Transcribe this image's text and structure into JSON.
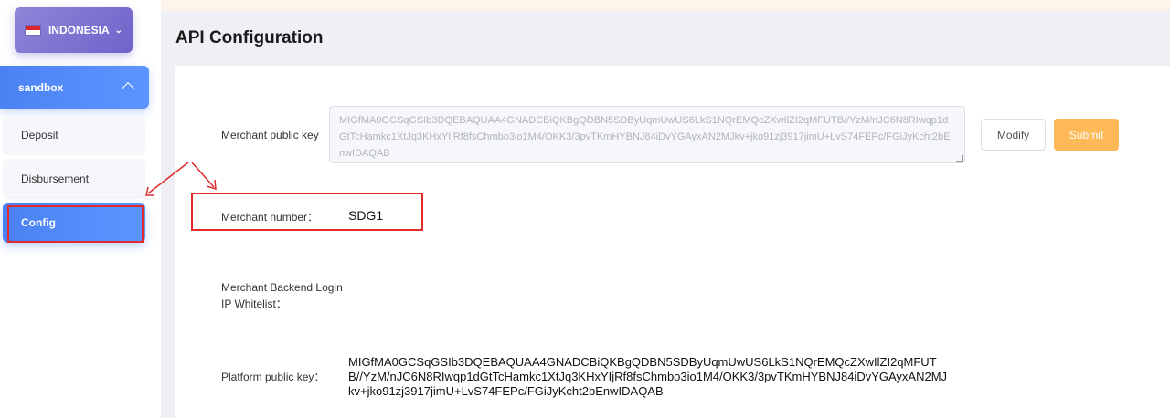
{
  "sidebar": {
    "country": "INDONESIA",
    "environment": "sandbox",
    "items": [
      {
        "label": "Deposit"
      },
      {
        "label": "Disbursement"
      },
      {
        "label": "Config"
      }
    ]
  },
  "page": {
    "title": "API Configuration"
  },
  "config": {
    "merchant_public_key_label": "Merchant public key",
    "merchant_public_key_value": "MIGfMA0GCSqGSIb3DQEBAQUAA4GNADCBiQKBgQDBN5SDByUqmUwUS6LkS1NQrEMQcZXwIlZI2qMFUTB//YzM/nJC6N8RIwqp1dGtTcHamkc1XtJq3KHxYIjRf8fsChmbo3io1M4/OKK3/3pvTKmHYBNJ84iDvYGAyxAN2MJkv+jko91zj3917jimU+LvS74FEPc/FGiJyKcht2bEnwIDAQAB",
    "modify_label": "Modify",
    "submit_label": "Submit",
    "merchant_number_label": "Merchant number：",
    "merchant_number_value": "SDG1",
    "ip_whitelist_label": "Merchant Backend Login IP Whitelist：",
    "platform_public_key_label": "Platform public key：",
    "platform_public_key_value": "MIGfMA0GCSqGSIb3DQEBAQUAA4GNADCBiQKBgQDBN5SDByUqmUwUS6LkS1NQrEMQcZXwIlZI2qMFUTB//YzM/nJC6N8RIwqp1dGtTcHamkc1XtJq3KHxYIjRf8fsChmbo3io1M4/OKK3/3pvTKmHYBNJ84iDvYGAyxAN2MJkv+jko91zj3917jimU+LvS74FEPc/FGiJyKcht2bEnwIDAQAB"
  },
  "colors": {
    "accent_blue": "#4a82f4",
    "country_purple": "#7c72d1",
    "submit_orange": "#fdb857",
    "annotation_red": "#e12b2b"
  }
}
